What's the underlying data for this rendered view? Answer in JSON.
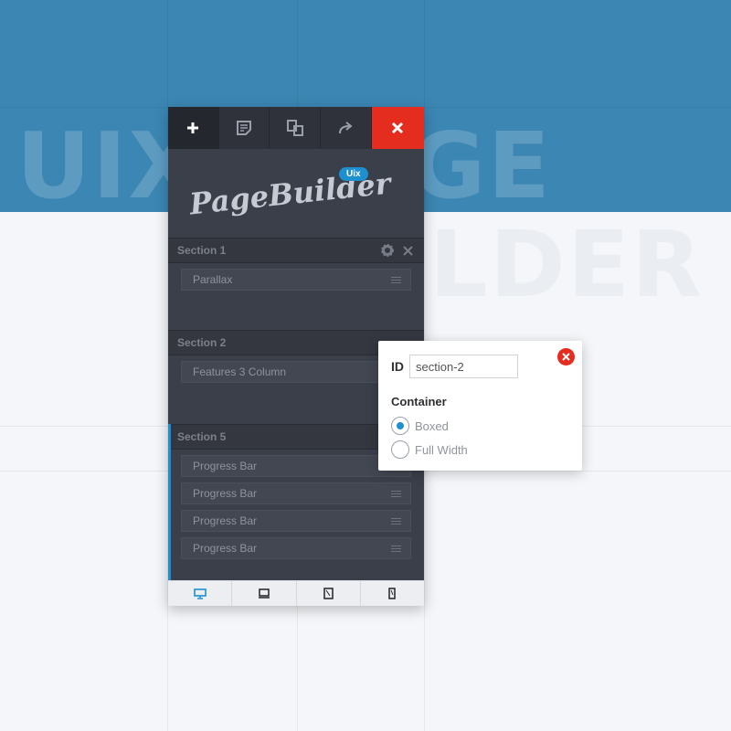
{
  "background": {
    "headline_line1": "UIX",
    "headline_line1_tail": "GE",
    "headline_line2": "LDER"
  },
  "toolbar": {
    "buttons": [
      {
        "icon": "plus-icon"
      },
      {
        "icon": "notes-icon"
      },
      {
        "icon": "duplicate-icon"
      },
      {
        "icon": "redo-icon"
      },
      {
        "icon": "close-icon"
      }
    ],
    "close_color": "#e42d1f"
  },
  "logo": {
    "text": "PageBuilder",
    "badge": "Uix"
  },
  "sections": [
    {
      "title": "Section 1",
      "modules": [
        "Parallax"
      ]
    },
    {
      "title": "Section 2",
      "modules": [
        "Features 3 Column"
      ]
    },
    {
      "title": "Section 5",
      "modules": [
        "Progress Bar",
        "Progress Bar",
        "Progress Bar",
        "Progress Bar"
      ]
    }
  ],
  "footer": {
    "devices": [
      "desktop-icon",
      "laptop-icon",
      "tablet-icon",
      "mobile-icon"
    ],
    "active": "desktop-icon"
  },
  "popup": {
    "id_label": "ID",
    "id_value": "section-2",
    "container_label": "Container",
    "options": [
      {
        "label": "Boxed",
        "checked": true
      },
      {
        "label": "Full Width",
        "checked": false
      }
    ]
  },
  "colors": {
    "accent": "#1e8fcf",
    "header_bg": "#3b86b3",
    "panel_bg": "#3b3f4a",
    "danger": "#e42d1f"
  }
}
